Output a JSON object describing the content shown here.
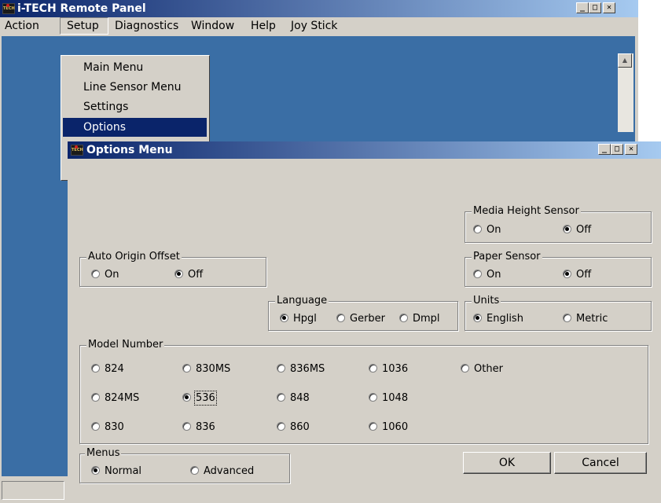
{
  "main_window": {
    "title": "i-TECH Remote Panel",
    "icon_label": "TECH",
    "caption_buttons": {
      "minimize": "_",
      "maximize": "□",
      "close": "✕"
    },
    "menu": [
      "Action",
      "Setup",
      "Diagnostics",
      "Window",
      "Help",
      "Joy Stick"
    ]
  },
  "setup_menu": {
    "items": [
      "Main Menu",
      "Line Sensor Menu",
      "Settings",
      "Options"
    ],
    "selected": "Options"
  },
  "dialog": {
    "title": "Options Menu",
    "icon_label": "TECH",
    "caption_buttons": {
      "minimize": "_",
      "maximize": "□",
      "close": "✕"
    },
    "media_height_sensor": {
      "legend": "Media Height Sensor",
      "on": "On",
      "off": "Off",
      "selected": "Off"
    },
    "auto_origin_offset": {
      "legend": "Auto Origin Offset",
      "on": "On",
      "off": "Off",
      "selected": "Off"
    },
    "paper_sensor": {
      "legend": "Paper Sensor",
      "on": "On",
      "off": "Off",
      "selected": "Off"
    },
    "language": {
      "legend": "Language",
      "options": [
        "Hpgl",
        "Gerber",
        "Dmpl"
      ],
      "selected": "Hpgl"
    },
    "units": {
      "legend": "Units",
      "options": [
        "English",
        "Metric"
      ],
      "selected": "English"
    },
    "model_number": {
      "legend": "Model Number",
      "rows": [
        [
          "824",
          "830MS",
          "836MS",
          "1036",
          "Other"
        ],
        [
          "824MS",
          "536",
          "848",
          "1048"
        ],
        [
          "830",
          "836",
          "860",
          "1060"
        ]
      ],
      "selected": "536"
    },
    "menus": {
      "legend": "Menus",
      "options": [
        "Normal",
        "Advanced"
      ],
      "selected": "Normal"
    },
    "ok_label": "OK",
    "cancel_label": "Cancel"
  }
}
